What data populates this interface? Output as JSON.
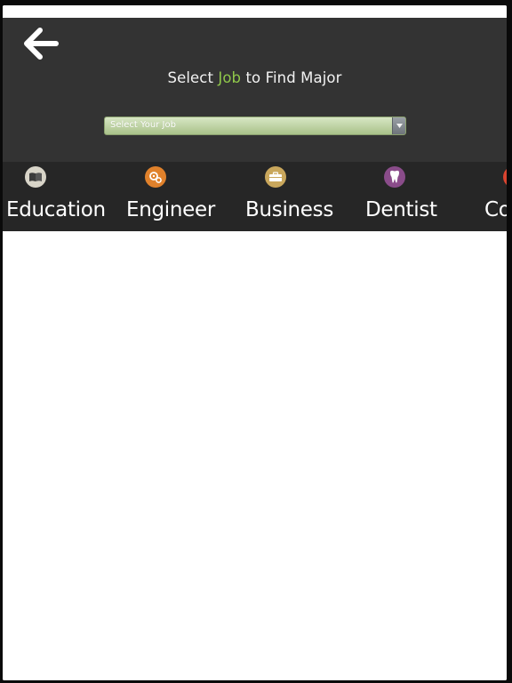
{
  "header": {
    "title_prefix": "Select ",
    "title_accent": "Job",
    "title_suffix": " to Find Major",
    "back_icon": "arrow-left-icon"
  },
  "job_select": {
    "placeholder": "Select Your Job",
    "dropdown_icon": "chevron-down-icon"
  },
  "categories": [
    {
      "label": "Education",
      "icon": "book-icon",
      "icon_color": "#d8d4c8"
    },
    {
      "label": "Engineer",
      "icon": "gears-icon",
      "icon_color": "#e0812b"
    },
    {
      "label": "Business",
      "icon": "briefcase-icon",
      "icon_color": "#c9a75c"
    },
    {
      "label": "Dentist",
      "icon": "tooth-icon",
      "icon_color": "#8a4c8a"
    },
    {
      "label": "Co",
      "icon": "category-icon",
      "icon_color": "#d9442f"
    }
  ],
  "colors": {
    "header_bg": "#333333",
    "category_bar_bg": "#262626",
    "accent": "#8fc64a"
  }
}
